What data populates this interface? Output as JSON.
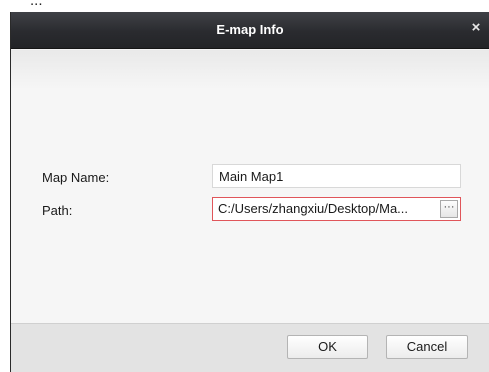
{
  "background_fragment": "...",
  "dialog": {
    "title": "E-map Info",
    "close_symbol": "×",
    "fields": {
      "map_name_label": "Map Name:",
      "map_name_value": "Main Map1",
      "path_label": "Path:",
      "path_value": "C:/Users/zhangxiu/Desktop/Ma...",
      "browse_symbol": "···"
    },
    "buttons": {
      "ok_label": "OK",
      "cancel_label": "Cancel"
    }
  },
  "colors": {
    "titlebar": "#2a2b2f",
    "path_error_border": "#e0555a",
    "footer": "#e3e3e3"
  },
  "icons": [
    "close-icon",
    "ellipsis-browse-icon"
  ]
}
